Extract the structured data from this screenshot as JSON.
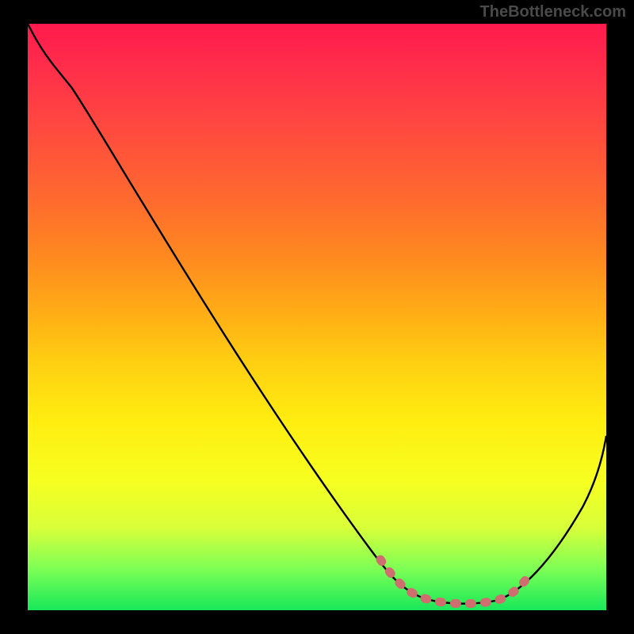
{
  "watermark": "TheBottleneck.com",
  "chart_data": {
    "type": "line",
    "title": "",
    "xlabel": "",
    "ylabel": "",
    "xlim": [
      0,
      100
    ],
    "ylim": [
      0,
      100
    ],
    "series": [
      {
        "name": "main-curve",
        "color": "#000000",
        "x": [
          0,
          4,
          10,
          20,
          30,
          40,
          50,
          57,
          60,
          63,
          66,
          70,
          75,
          80,
          86,
          92,
          100
        ],
        "values": [
          100,
          96,
          90,
          78,
          64,
          50,
          35,
          22,
          14,
          8,
          4,
          2,
          2,
          3,
          8,
          17,
          34
        ]
      },
      {
        "name": "highlight-band",
        "color": "#d06a6a",
        "x": [
          62,
          66,
          70,
          75,
          80,
          84
        ],
        "values": [
          9,
          4,
          2,
          2,
          3,
          6
        ]
      }
    ],
    "gradient_stops": [
      {
        "pos": 0,
        "color": "#ff1a4d"
      },
      {
        "pos": 18,
        "color": "#ff4a3f"
      },
      {
        "pos": 40,
        "color": "#ff8a1f"
      },
      {
        "pos": 58,
        "color": "#ffd012"
      },
      {
        "pos": 78,
        "color": "#f6ff20"
      },
      {
        "pos": 93,
        "color": "#7cff55"
      },
      {
        "pos": 100,
        "color": "#18e85a"
      }
    ]
  }
}
